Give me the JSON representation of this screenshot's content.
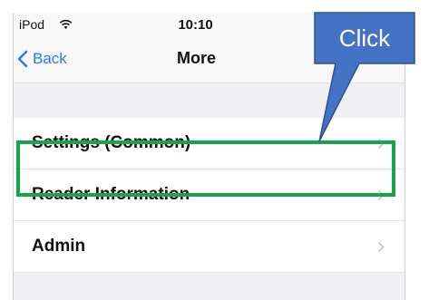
{
  "status_bar": {
    "device": "iPod",
    "time": "10:10"
  },
  "nav": {
    "back_label": "Back",
    "title": "More"
  },
  "menu": {
    "items": [
      {
        "label": "Settings (Common)"
      },
      {
        "label": "Reader Information"
      },
      {
        "label": "Admin"
      }
    ]
  },
  "annotation": {
    "callout_text": "Click",
    "callout_color": "#4472c4",
    "highlight_color": "#13a64a"
  },
  "colors": {
    "accent": "#2b7de9"
  }
}
